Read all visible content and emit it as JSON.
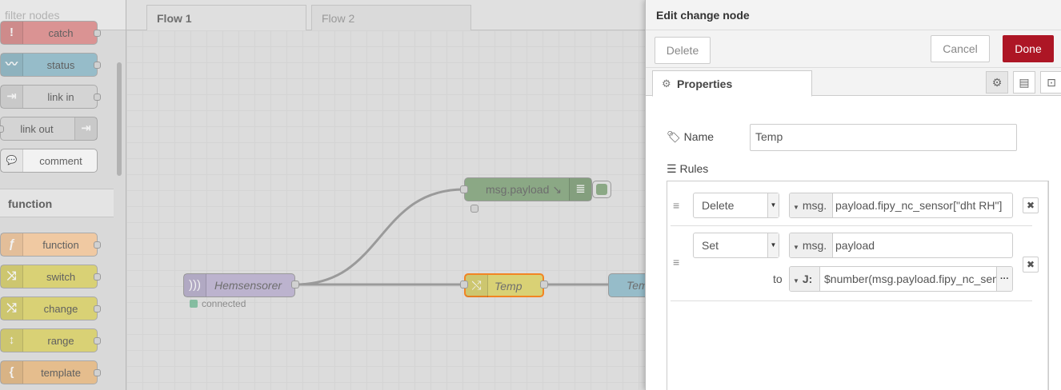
{
  "palette": {
    "search_placeholder": "filter nodes",
    "top_nodes": [
      {
        "label": "catch",
        "icon": "!",
        "color": "#e49191"
      },
      {
        "label": "status",
        "icon": "〰",
        "color": "#94c1d0"
      },
      {
        "label": "link in",
        "icon": "⇥",
        "color": "#dddddd"
      },
      {
        "label": "link out",
        "icon": "⇥",
        "color": "#dddddd"
      },
      {
        "label": "comment",
        "icon": "💬",
        "color": "#ffffff"
      }
    ],
    "category_function": "function",
    "function_nodes": [
      {
        "label": "function",
        "icon": "ƒ",
        "color": "#fdd0a2"
      },
      {
        "label": "switch",
        "icon": "⤨",
        "color": "#e2d96e"
      },
      {
        "label": "change",
        "icon": "⤭",
        "color": "#e2d96e"
      },
      {
        "label": "range",
        "icon": "↕",
        "color": "#e2d96e"
      },
      {
        "label": "template",
        "icon": "{",
        "color": "#f0c28a"
      }
    ]
  },
  "workspace": {
    "tabs": [
      "Flow 1",
      "Flow 2"
    ],
    "nodes": {
      "debug": {
        "label": "msg.payload ↘",
        "color": "#87a980"
      },
      "sensor": {
        "label": "Hemsensorer",
        "color": "#c0b6d6"
      },
      "change": {
        "label": "Temp",
        "color": "#e2d96e",
        "border": "#ff7f0e"
      },
      "out": {
        "label": "Tem",
        "color": "#94c1d0"
      }
    },
    "status_text": "connected"
  },
  "tray": {
    "title": "Edit change node",
    "delete_label": "Delete",
    "cancel_label": "Cancel",
    "done_label": "Done",
    "properties_tab": "Properties",
    "name_label": "Name",
    "name_value": "Temp",
    "rules_label": "Rules",
    "rules": [
      {
        "action": "Delete",
        "type": "msg.",
        "value": "payload.fipy_nc_sensor[\"dht RH\"]"
      },
      {
        "action": "Set",
        "type": "msg.",
        "value": "payload",
        "to_label": "to",
        "to_type": "J:",
        "to_value": "$number(msg.payload.fipy_nc_sen"
      }
    ]
  },
  "colors": {
    "done": "#ad1625",
    "selected_border": "#ff7f0e"
  }
}
